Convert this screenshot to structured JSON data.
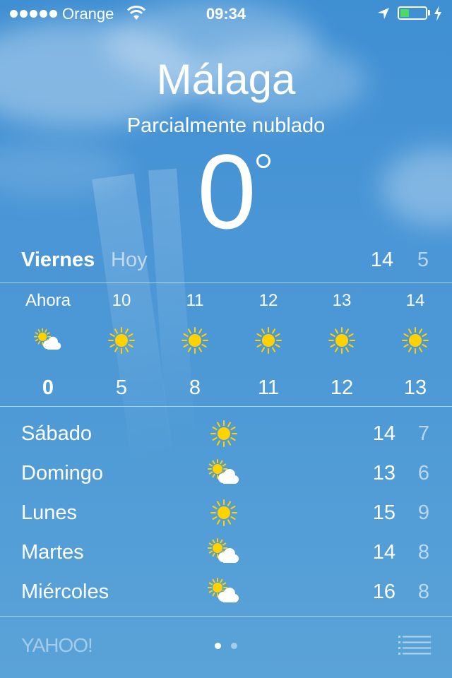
{
  "status_bar": {
    "carrier": "Orange",
    "time": "09:34",
    "battery_level": 0.35
  },
  "location": {
    "city": "Málaga",
    "condition": "Parcialmente nublado",
    "current_temp": "0"
  },
  "today": {
    "day": "Viernes",
    "label": "Hoy",
    "high": "14",
    "low": "5"
  },
  "hourly": [
    {
      "time": "Ahora",
      "icon": "partly-cloudy-icon",
      "temp": "0"
    },
    {
      "time": "10",
      "icon": "sun-icon",
      "temp": "5"
    },
    {
      "time": "11",
      "icon": "sun-icon",
      "temp": "8"
    },
    {
      "time": "12",
      "icon": "sun-icon",
      "temp": "11"
    },
    {
      "time": "13",
      "icon": "sun-icon",
      "temp": "12"
    },
    {
      "time": "14",
      "icon": "sun-icon",
      "temp": "13"
    }
  ],
  "daily": [
    {
      "day": "Sábado",
      "icon": "sun-icon",
      "high": "14",
      "low": "7"
    },
    {
      "day": "Domingo",
      "icon": "partly-cloudy-icon",
      "high": "13",
      "low": "6"
    },
    {
      "day": "Lunes",
      "icon": "sun-icon",
      "high": "15",
      "low": "9"
    },
    {
      "day": "Martes",
      "icon": "partly-cloudy-icon",
      "high": "14",
      "low": "8"
    },
    {
      "day": "Miércoles",
      "icon": "partly-cloudy-icon",
      "high": "16",
      "low": "8"
    }
  ],
  "footer": {
    "provider": "YAHOO!",
    "page_count": 2,
    "active_page": 1
  },
  "colors": {
    "sun": "#ffd200",
    "battery": "#4cd964",
    "sky": "#4a96d6"
  }
}
